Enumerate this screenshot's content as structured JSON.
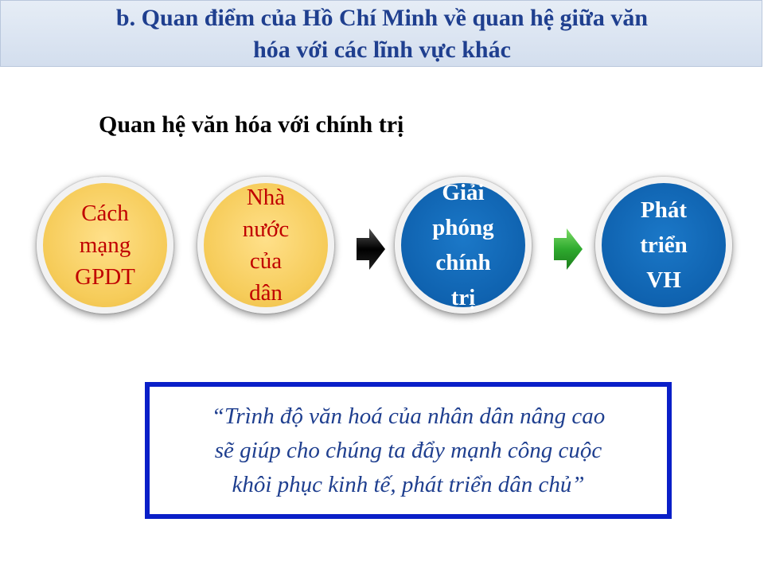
{
  "header": {
    "title": "b. Quan điểm của Hồ Chí Minh về quan hệ giữa văn\nhóa với các lĩnh vực khác"
  },
  "subtitle": "Quan hệ văn hóa với chính trị",
  "flow": {
    "items": [
      {
        "label": "Cách\nmạng\nGPDT",
        "style": "yellow"
      },
      {
        "label": "Nhà\nnước\ncủa\ndân",
        "style": "yellow"
      },
      {
        "label": "Giải\nphóng\nchính\ntrị",
        "style": "blue"
      },
      {
        "label": "Phát\ntriển\nVH",
        "style": "blue"
      }
    ],
    "arrows": [
      {
        "icon": "black-arrow-icon",
        "color": "#000000"
      },
      {
        "icon": "green-arrow-icon",
        "color": "#2eaa2e"
      }
    ]
  },
  "quote": "“Trình độ văn hoá của nhân dân nâng cao\nsẽ giúp cho chúng ta đẩy mạnh công cuộc\nkhôi phục kinh tế, phát triển dân chủ”",
  "colors": {
    "title": "#1f3f8f",
    "yellow_circle": "#f6cc5a",
    "yellow_text": "#c00000",
    "blue_circle": "#0f62af",
    "quote_border": "#0a1fc8"
  }
}
